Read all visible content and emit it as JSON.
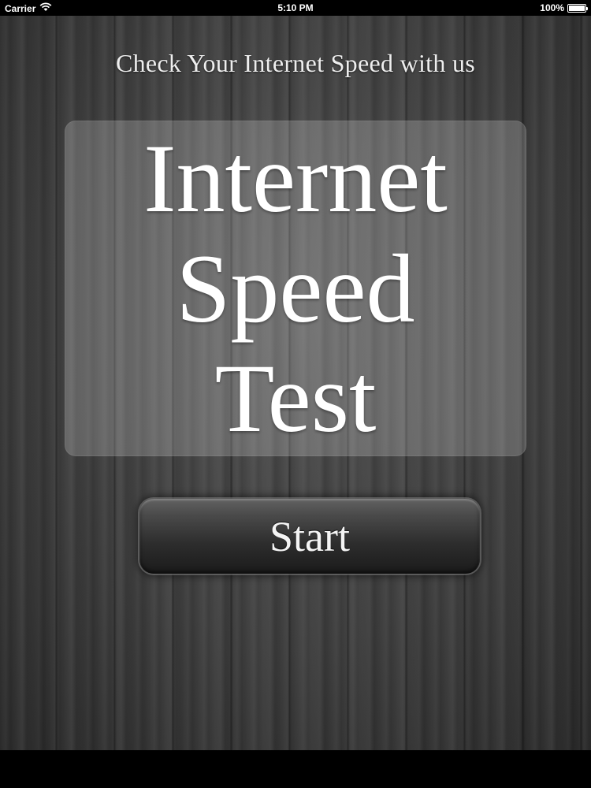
{
  "status_bar": {
    "carrier": "Carrier",
    "time": "5:10 PM",
    "battery_text": "100%",
    "battery_level": 1.0,
    "wifi_icon": "wifi-icon"
  },
  "app": {
    "subtitle": "Check Your Internet Speed with us",
    "title_lines": [
      "Internet",
      "Speed",
      "Test"
    ],
    "start_button_label": "Start"
  },
  "colors": {
    "background": "#3b3b3b",
    "text": "#ffffff",
    "panel": "rgba(255,255,255,0.20)",
    "button": "#2d2d2d"
  }
}
